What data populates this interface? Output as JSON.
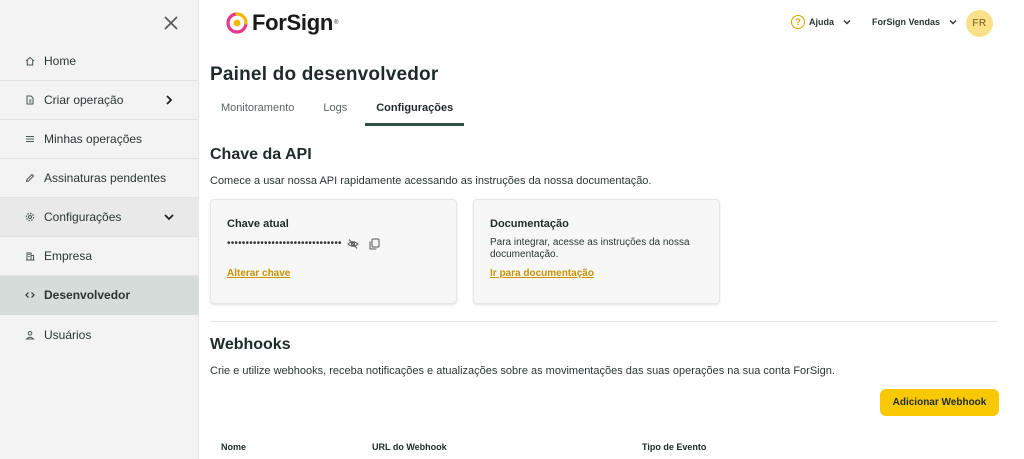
{
  "brand": {
    "name": "ForSign",
    "reg": "®"
  },
  "header": {
    "help_label": "Ajuda",
    "account_label": "ForSign Vendas",
    "avatar_initials": "FR"
  },
  "sidebar": {
    "items": [
      {
        "label": "Home",
        "icon": "home-icon"
      },
      {
        "label": "Criar operação",
        "icon": "document-icon"
      },
      {
        "label": "Minhas operações",
        "icon": "list-icon"
      },
      {
        "label": "Assinaturas pendentes",
        "icon": "pen-icon"
      },
      {
        "label": "Configurações",
        "icon": "gear-icon"
      },
      {
        "label": "Empresa",
        "icon": "building-icon"
      },
      {
        "label": "Desenvolvedor",
        "icon": "code-icon"
      },
      {
        "label": "Usuários",
        "icon": "user-icon"
      }
    ]
  },
  "main": {
    "title": "Painel do desenvolvedor",
    "tabs": [
      {
        "label": "Monitoramento"
      },
      {
        "label": "Logs"
      },
      {
        "label": "Configurações"
      }
    ],
    "api": {
      "title": "Chave da API",
      "desc": "Comece a usar nossa API rapidamente acessando as instruções da nossa documentação.",
      "key_card": {
        "title": "Chave atual",
        "masked_key": "•••••••••••••••••••••••••••••••",
        "link": "Alterar chave"
      },
      "doc_card": {
        "title": "Documentação",
        "text": "Para integrar, acesse as instruções da nossa documentação.",
        "link": "Ir para documentação"
      }
    },
    "webhooks": {
      "title": "Webhooks",
      "desc": "Crie e utilize webhooks, receba notificações e atualizações sobre as movimentações das suas operações na sua conta ForSign.",
      "add_button": "Adicionar Webhook",
      "columns": [
        "Nome",
        "URL do Webhook",
        "Tipo de Evento"
      ]
    }
  },
  "colors": {
    "accent": "#f8c800",
    "link": "#c79300",
    "active_tab": "#2f4e46",
    "active_nav": "#d5dcd9"
  }
}
